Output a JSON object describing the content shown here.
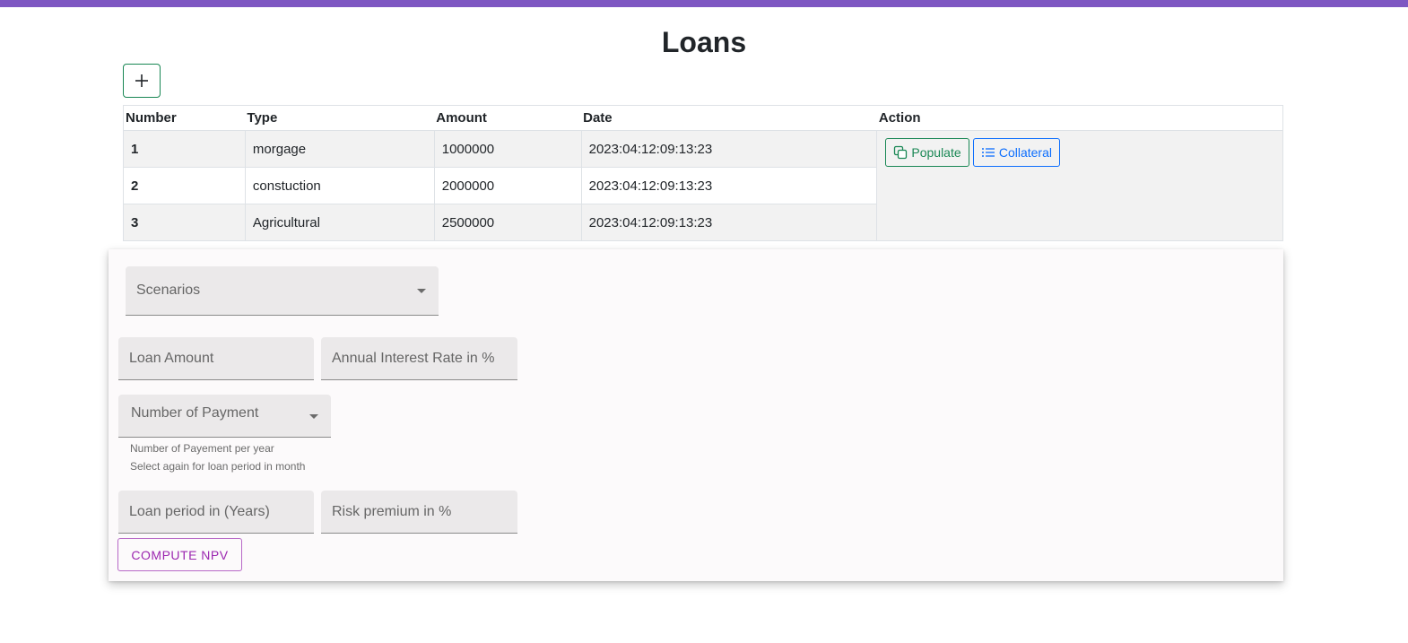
{
  "theme": {
    "top_bar_color": "#7e57c2",
    "success_color": "#198754",
    "primary_color": "#0d6efd",
    "accent_color": "#9c27b0"
  },
  "page": {
    "title": "Loans",
    "add_button_icon": "plus-icon"
  },
  "table": {
    "headers": [
      "Number",
      "Type",
      "Amount",
      "Date",
      "Action"
    ],
    "rows": [
      {
        "number": "1",
        "type": "morgage",
        "amount": "1000000",
        "date": "2023:04:12:09:13:23"
      },
      {
        "number": "2",
        "type": "constuction",
        "amount": "2000000",
        "date": "2023:04:12:09:13:23"
      },
      {
        "number": "3",
        "type": "Agricultural",
        "amount": "2500000",
        "date": "2023:04:12:09:13:23"
      }
    ],
    "actions": {
      "populate_label": "Populate",
      "populate_icon": "copy-icon",
      "collateral_label": "Collateral",
      "collateral_icon": "list-icon"
    }
  },
  "form": {
    "scenarios_label": "Scenarios",
    "loan_amount_label": "Loan Amount",
    "interest_rate_label": "Annual Interest Rate in %",
    "payments_label": "Number of Payment",
    "payments_helper_1": "Number of Payement per year",
    "payments_helper_2": "Select again for loan period in month",
    "loan_period_label": "Loan period in (Years)",
    "risk_premium_label": "Risk premium in %",
    "compute_button": "COMPUTE NPV"
  }
}
